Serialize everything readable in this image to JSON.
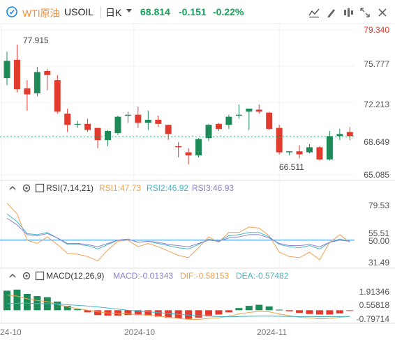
{
  "header": {
    "name": "WTI原油",
    "code": "USOIL",
    "period": "日K",
    "price": "68.814",
    "change": "-0.151",
    "change_pct": "-0.22%"
  },
  "toolbar": {
    "icons": [
      "indicator-settings-icon",
      "draw-icon",
      "tools-icon",
      "fullscreen-icon",
      "close-icon"
    ]
  },
  "main_chart": {
    "y_ticks": [
      "79.340",
      "75.777",
      "72.213",
      "68.649",
      "65.085"
    ],
    "high_label": "77.915",
    "low_label": "66.511"
  },
  "rsi": {
    "label": "RSI(7,14,21)",
    "rsi1": "RSI1:47.73",
    "rsi2": "RSI2:46.92",
    "rsi3": "RSI3:46.93",
    "y_ticks": [
      "79.53",
      "55.51",
      "50.00",
      "31.49"
    ]
  },
  "macd": {
    "label": "MACD(12,26,9)",
    "macd": "MACD:-0.01343",
    "dif": "DIF:-0.58153",
    "dea": "DEA:-0.57482",
    "y_ticks": [
      "1.91346",
      "0.55818",
      "-0.79714"
    ]
  },
  "x_labels": [
    "24-10",
    "2024-10",
    "2024-11"
  ],
  "colors": {
    "up": "#1d8a57",
    "down": "#e23a2d",
    "rsi1": "#f0a050",
    "rsi2": "#42b8c8",
    "rsi3": "#8f7fcf",
    "accent": "#ff8a2a"
  },
  "chart_data": [
    {
      "type": "candlestick",
      "title": "WTI原油 USOIL 日K",
      "ylim": [
        65.085,
        79.34
      ],
      "x": [
        "1",
        "2",
        "3",
        "4",
        "5",
        "6",
        "7",
        "8",
        "9",
        "10",
        "11",
        "12",
        "13",
        "14",
        "15",
        "16",
        "17",
        "18",
        "19",
        "20",
        "21",
        "22",
        "23",
        "24",
        "25",
        "26",
        "27",
        "28",
        "29",
        "30",
        "31",
        "32",
        "33",
        "34",
        "35"
      ],
      "ohlc": [
        [
          74.6,
          77.2,
          73.9,
          76.3
        ],
        [
          76.4,
          77.9,
          73.2,
          73.5
        ],
        [
          73.6,
          74.4,
          71.4,
          73.0
        ],
        [
          73.1,
          75.7,
          72.8,
          75.2
        ],
        [
          75.3,
          75.5,
          73.4,
          74.9
        ],
        [
          74.4,
          74.9,
          71.1,
          71.3
        ],
        [
          71.1,
          71.6,
          69.3,
          70.0
        ],
        [
          70.1,
          70.4,
          69.7,
          70.1
        ],
        [
          70.1,
          70.6,
          69.3,
          69.5
        ],
        [
          69.7,
          69.7,
          67.7,
          68.5
        ],
        [
          68.5,
          69.5,
          67.9,
          69.4
        ],
        [
          69.2,
          70.9,
          69.0,
          70.8
        ],
        [
          70.9,
          71.3,
          70.2,
          71.0
        ],
        [
          71.0,
          71.8,
          69.7,
          70.2
        ],
        [
          70.2,
          71.4,
          69.5,
          70.5
        ],
        [
          70.5,
          70.9,
          69.8,
          70.1
        ],
        [
          70.0,
          70.0,
          68.5,
          69.1
        ],
        [
          67.9,
          68.3,
          66.8,
          67.8
        ],
        [
          67.3,
          67.7,
          66.1,
          67.0
        ],
        [
          67.0,
          68.7,
          66.8,
          68.6
        ],
        [
          68.7,
          70.1,
          68.4,
          70.0
        ],
        [
          70.1,
          70.2,
          69.4,
          69.6
        ],
        [
          70.0,
          71.0,
          69.6,
          70.8
        ],
        [
          70.9,
          72.0,
          70.6,
          71.0
        ],
        [
          71.3,
          71.5,
          69.5,
          71.6
        ],
        [
          71.5,
          72.0,
          71.1,
          71.3
        ],
        [
          71.2,
          71.3,
          69.5,
          69.6
        ],
        [
          69.7,
          70.0,
          67.1,
          67.3
        ],
        [
          67.3,
          67.4,
          67.0,
          67.4
        ],
        [
          67.4,
          68.0,
          66.7,
          67.1
        ],
        [
          67.3,
          68.1,
          67.2,
          67.8
        ],
        [
          67.8,
          67.9,
          66.5,
          66.6
        ],
        [
          66.6,
          69.4,
          66.5,
          68.9
        ],
        [
          68.9,
          69.6,
          68.5,
          69.1
        ],
        [
          69.3,
          69.8,
          68.5,
          68.9
        ]
      ]
    },
    {
      "type": "line",
      "title": "RSI(7,14,21)",
      "ylim": [
        25,
        90
      ],
      "x": [
        "1",
        "2",
        "3",
        "4",
        "5",
        "6",
        "7",
        "8",
        "9",
        "10",
        "11",
        "12",
        "13",
        "14",
        "15",
        "16",
        "17",
        "18",
        "19",
        "20",
        "21",
        "22",
        "23",
        "24",
        "25",
        "26",
        "27",
        "28",
        "29",
        "30",
        "31",
        "32",
        "33",
        "34",
        "35"
      ],
      "series": [
        {
          "name": "RSI1",
          "values": [
            84,
            74,
            50,
            47,
            53,
            46,
            38,
            37,
            35,
            31,
            41,
            49,
            50,
            44,
            47,
            44,
            40,
            36,
            34,
            43,
            53,
            48,
            57,
            57,
            62,
            61,
            54,
            39,
            35,
            34,
            39,
            32,
            48,
            55,
            48
          ]
        },
        {
          "name": "RSI2",
          "values": [
            74,
            67,
            56,
            55,
            57,
            52,
            46,
            46,
            45,
            42,
            46,
            50,
            51,
            48,
            49,
            47,
            45,
            43,
            42,
            46,
            51,
            49,
            54,
            55,
            57,
            57,
            53,
            46,
            44,
            43,
            45,
            42,
            48,
            51,
            49
          ]
        },
        {
          "name": "RSI3",
          "values": [
            70,
            64,
            55,
            54,
            56,
            52,
            47,
            47,
            46,
            44,
            47,
            50,
            51,
            48,
            49,
            48,
            46,
            45,
            44,
            47,
            50,
            49,
            52,
            53,
            55,
            55,
            52,
            47,
            45,
            45,
            46,
            44,
            48,
            50,
            49
          ]
        }
      ]
    },
    {
      "type": "bar",
      "title": "MACD(12,26,9)",
      "ylim": [
        -1.2,
        2.4
      ],
      "x": [
        "1",
        "2",
        "3",
        "4",
        "5",
        "6",
        "7",
        "8",
        "9",
        "10",
        "11",
        "12",
        "13",
        "14",
        "15",
        "16",
        "17",
        "18",
        "19",
        "20",
        "21",
        "22",
        "23",
        "24",
        "25",
        "26",
        "27",
        "28",
        "29",
        "30",
        "31",
        "32",
        "33",
        "34",
        "35"
      ],
      "series": [
        {
          "name": "MACD",
          "values": [
            1.8,
            1.9,
            1.5,
            1.3,
            1.2,
            0.8,
            0.4,
            0.1,
            -0.2,
            -0.45,
            -0.5,
            -0.5,
            -0.45,
            -0.45,
            -0.5,
            -0.6,
            -0.7,
            -0.75,
            -0.8,
            -0.7,
            -0.5,
            -0.4,
            -0.2,
            0.2,
            0.4,
            0.5,
            0.35,
            0.05,
            -0.1,
            -0.25,
            -0.35,
            -0.4,
            -0.4,
            -0.3,
            -0.01
          ]
        },
        {
          "name": "DIF",
          "values": [
            1.4,
            1.3,
            1.05,
            0.9,
            0.8,
            0.55,
            0.3,
            0.15,
            0.0,
            -0.15,
            -0.25,
            -0.3,
            -0.35,
            -0.4,
            -0.45,
            -0.55,
            -0.65,
            -0.75,
            -0.85,
            -0.85,
            -0.75,
            -0.7,
            -0.55,
            -0.35,
            -0.2,
            -0.1,
            -0.15,
            -0.35,
            -0.5,
            -0.65,
            -0.7,
            -0.8,
            -0.75,
            -0.65,
            -0.58
          ]
        },
        {
          "name": "DEA",
          "values": [
            0.6,
            0.65,
            0.65,
            0.62,
            0.6,
            0.58,
            0.5,
            0.45,
            0.38,
            0.3,
            0.2,
            0.1,
            0.0,
            -0.08,
            -0.15,
            -0.22,
            -0.3,
            -0.38,
            -0.45,
            -0.5,
            -0.55,
            -0.58,
            -0.6,
            -0.58,
            -0.56,
            -0.55,
            -0.55,
            -0.56,
            -0.57,
            -0.58,
            -0.58,
            -0.59,
            -0.58,
            -0.58,
            -0.57
          ]
        }
      ]
    }
  ]
}
